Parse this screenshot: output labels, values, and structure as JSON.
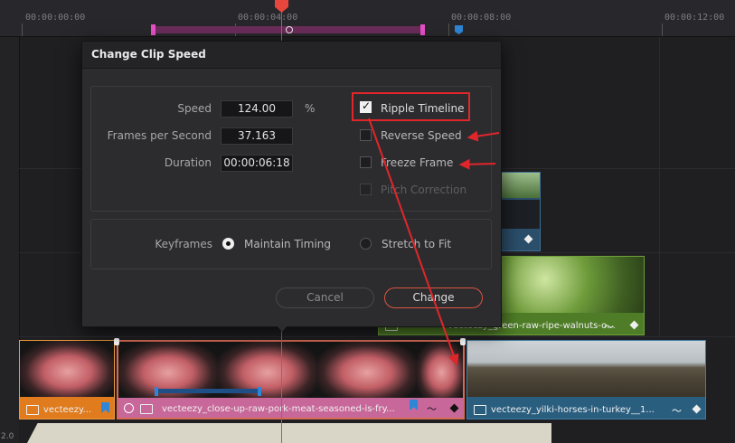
{
  "ruler": {
    "timecodes": [
      "00:00:00:00",
      "00:00:04:00",
      "00:00:08:00",
      "00:00:12:00"
    ]
  },
  "left_header": {
    "label": "2.0"
  },
  "dialog": {
    "title": "Change Clip Speed",
    "speed": {
      "label": "Speed",
      "value": "124.00",
      "unit": "%"
    },
    "fps": {
      "label": "Frames per Second",
      "value": "37.163"
    },
    "duration": {
      "label": "Duration",
      "value": "00:00:06:18"
    },
    "options": {
      "ripple": {
        "label": "Ripple Timeline",
        "checked": true
      },
      "reverse": {
        "label": "Reverse Speed",
        "checked": false
      },
      "freeze": {
        "label": "Freeze Frame",
        "checked": false
      },
      "pitch": {
        "label": "Pitch Correction",
        "checked": false,
        "disabled": true
      }
    },
    "keyframes": {
      "label": "Keyframes",
      "maintain": "Maintain Timing",
      "stretch": "Stretch to Fit",
      "selected": "maintain"
    },
    "cancel_label": "Cancel",
    "change_label": "Change"
  },
  "clips": {
    "orange": {
      "name": "vecteezy...",
      "color": "#e07b1e"
    },
    "pink": {
      "name": "vecteezy_close-up-raw-pork-meat-seasoned-is-fry...",
      "color": "#c8689a"
    },
    "blue": {
      "name": "vecteezy_yilki-horses-in-turkey__1...",
      "color": "#2a5e7f"
    },
    "green": {
      "name": "vecteezy_green-raw-ripe-walnuts-o...",
      "color": "#4f7d27"
    }
  },
  "colors": {
    "playhead": "#e8453c",
    "highlight": "#e0262a",
    "selected_border": "#d66a52"
  }
}
